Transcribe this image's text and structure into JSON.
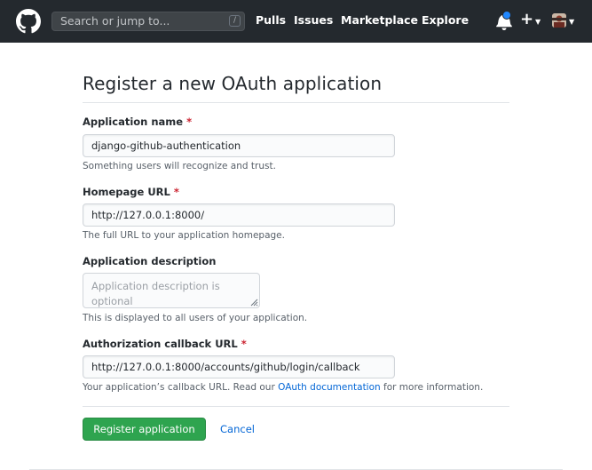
{
  "header": {
    "search_placeholder": "Search or jump to...",
    "search_shortcut": "/",
    "nav": [
      "Pulls",
      "Issues",
      "Marketplace",
      "Explore"
    ]
  },
  "page": {
    "title": "Register a new OAuth application"
  },
  "form": {
    "app_name": {
      "label": "Application name",
      "required_mark": "*",
      "value": "django-github-authentication",
      "note": "Something users will recognize and trust."
    },
    "homepage_url": {
      "label": "Homepage URL",
      "required_mark": "*",
      "value": "http://127.0.0.1:8000/",
      "note": "The full URL to your application homepage."
    },
    "description": {
      "label": "Application description",
      "placeholder_line1": "Application description is",
      "placeholder_line2": "optional",
      "note": "This is displayed to all users of your application."
    },
    "callback_url": {
      "label": "Authorization callback URL",
      "required_mark": "*",
      "value": "http://127.0.0.1:8000/accounts/github/login/callback",
      "note_prefix": "Your application’s callback URL. Read our",
      "note_link": "OAuth documentation",
      "note_suffix": "for more information."
    }
  },
  "actions": {
    "register_label": "Register application",
    "cancel_label": "Cancel"
  },
  "icons": {
    "logo": "github-logo-icon",
    "bell": "bell-icon",
    "plus": "plus-icon",
    "avatar": "avatar"
  },
  "colors": {
    "header_bg": "#24292e",
    "primary_button": "#2ea44f",
    "link": "#0366d6",
    "required": "#cb2431",
    "notification_dot": "#2188ff"
  }
}
